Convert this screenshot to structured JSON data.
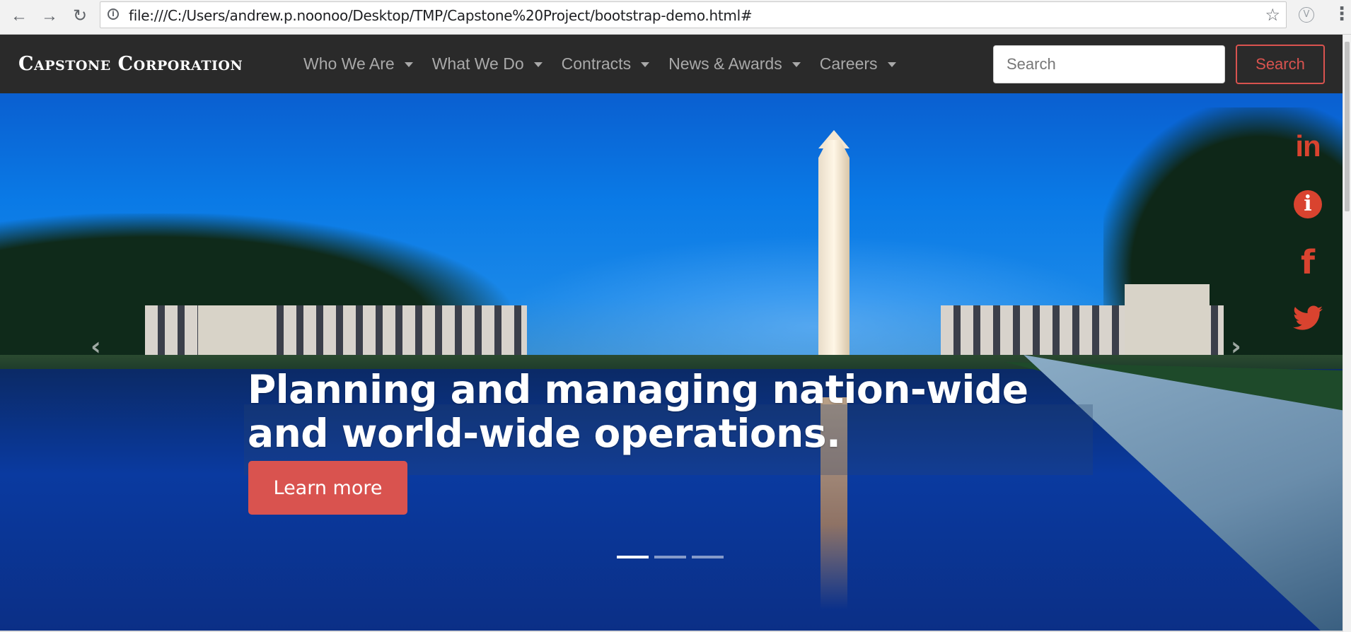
{
  "browser": {
    "url": "file:///C:/Users/andrew.p.noonoo/Desktop/TMP/Capstone%20Project/bootstrap-demo.html#",
    "back_icon": "arrow-left-icon",
    "forward_icon": "arrow-right-icon",
    "reload_icon": "reload-icon",
    "bookmark_icon": "star-icon",
    "extension_label": "V",
    "menu_icon": "more-vertical-icon"
  },
  "navbar": {
    "brand": "Capstone Corporation",
    "items": [
      {
        "label": "Who We Are"
      },
      {
        "label": "What We Do"
      },
      {
        "label": "Contracts"
      },
      {
        "label": "News & Awards"
      },
      {
        "label": "Careers"
      }
    ],
    "search": {
      "placeholder": "Search",
      "value": "",
      "button_label": "Search"
    }
  },
  "hero": {
    "caption": "Planning and managing nation-wide and world-wide operations.",
    "cta_label": "Learn more",
    "slides_total": 3,
    "active_slide": 1
  },
  "social": {
    "linkedin_text": "in",
    "info_text": "i",
    "facebook_text": "f",
    "icons": [
      "linkedin-icon",
      "info-icon",
      "facebook-icon",
      "twitter-icon"
    ]
  },
  "colors": {
    "accent": "#d9534f",
    "social_icon": "#d9432f",
    "navbar_bg": "#2a2a2a",
    "nav_text": "#a9a9a9"
  }
}
